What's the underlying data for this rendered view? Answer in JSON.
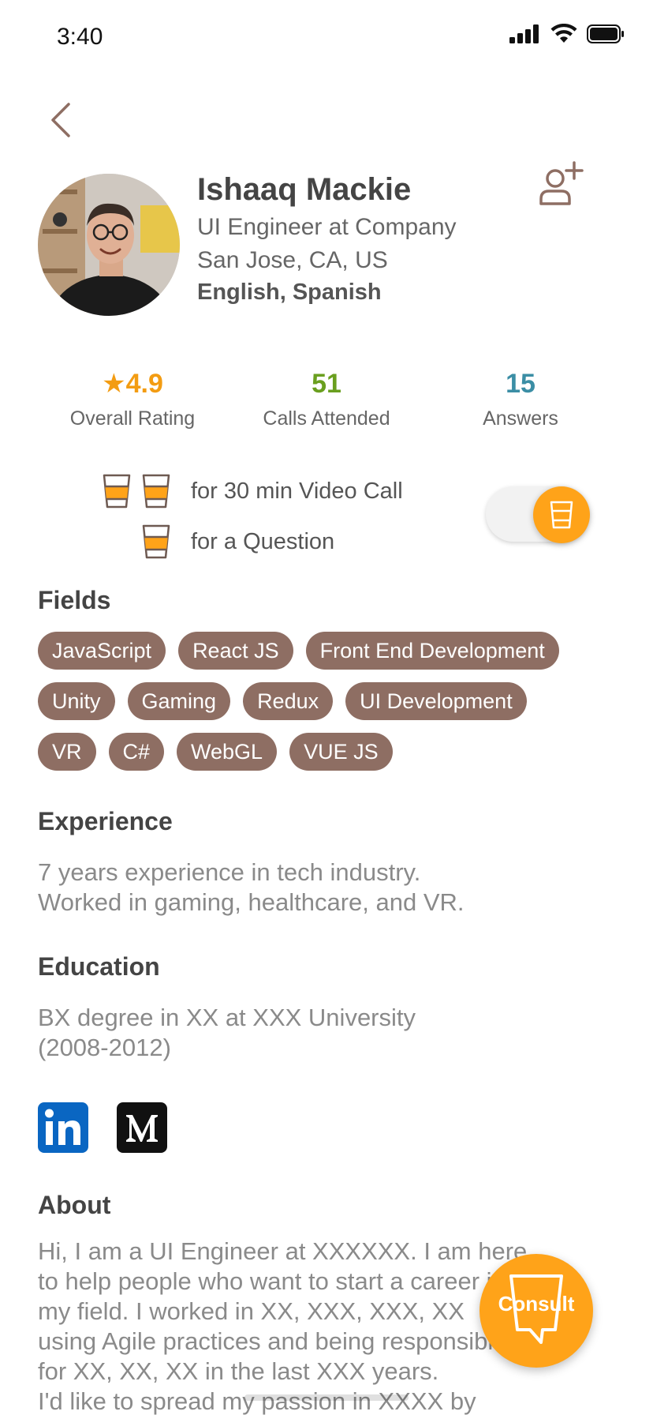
{
  "status_bar": {
    "time": "3:40"
  },
  "profile": {
    "name": "Ishaaq Mackie",
    "role": "UI Engineer at Company",
    "location": "San Jose, CA, US",
    "languages": "English, Spanish"
  },
  "stats": [
    {
      "value": "4.9",
      "prefix": "★",
      "label": "Overall Rating",
      "color": "#f39c12"
    },
    {
      "value": "51",
      "prefix": "",
      "label": "Calls Attended",
      "color": "#6a9f1f"
    },
    {
      "value": "15",
      "prefix": "",
      "label": "Answers",
      "color": "#3b8ea5"
    }
  ],
  "pricing": {
    "video_call": "for 30 min Video Call",
    "question": "for a Question"
  },
  "sections": {
    "fields_title": "Fields",
    "experience_title": "Experience",
    "education_title": "Education",
    "about_title": "About"
  },
  "fields": [
    [
      "JavaScript",
      "React JS",
      "Front End Development"
    ],
    [
      "Unity",
      "Gaming",
      "Redux",
      "UI Development"
    ],
    [
      "VR",
      "C#",
      "WebGL",
      "VUE JS"
    ]
  ],
  "experience": {
    "line1": "7 years experience in tech industry.",
    "line2": "Worked in gaming, healthcare, and VR."
  },
  "education": {
    "line1": "BX degree in XX at XXX University",
    "line2": "(2008-2012)"
  },
  "about": {
    "lines": [
      "Hi, I am a UI Engineer at XXXXXX. I am here",
      "to help people who want to start a career in",
      "my field. I worked in XX, XXX, XXX, XX",
      "using Agile practices and being responsible",
      "for XX, XX, XX in the last XXX years.",
      "I'd like to spread my passion in XXXX by"
    ]
  },
  "consult": {
    "label": "Consult"
  },
  "colors": {
    "accent": "#ffa319",
    "chip": "#8e6e63"
  }
}
